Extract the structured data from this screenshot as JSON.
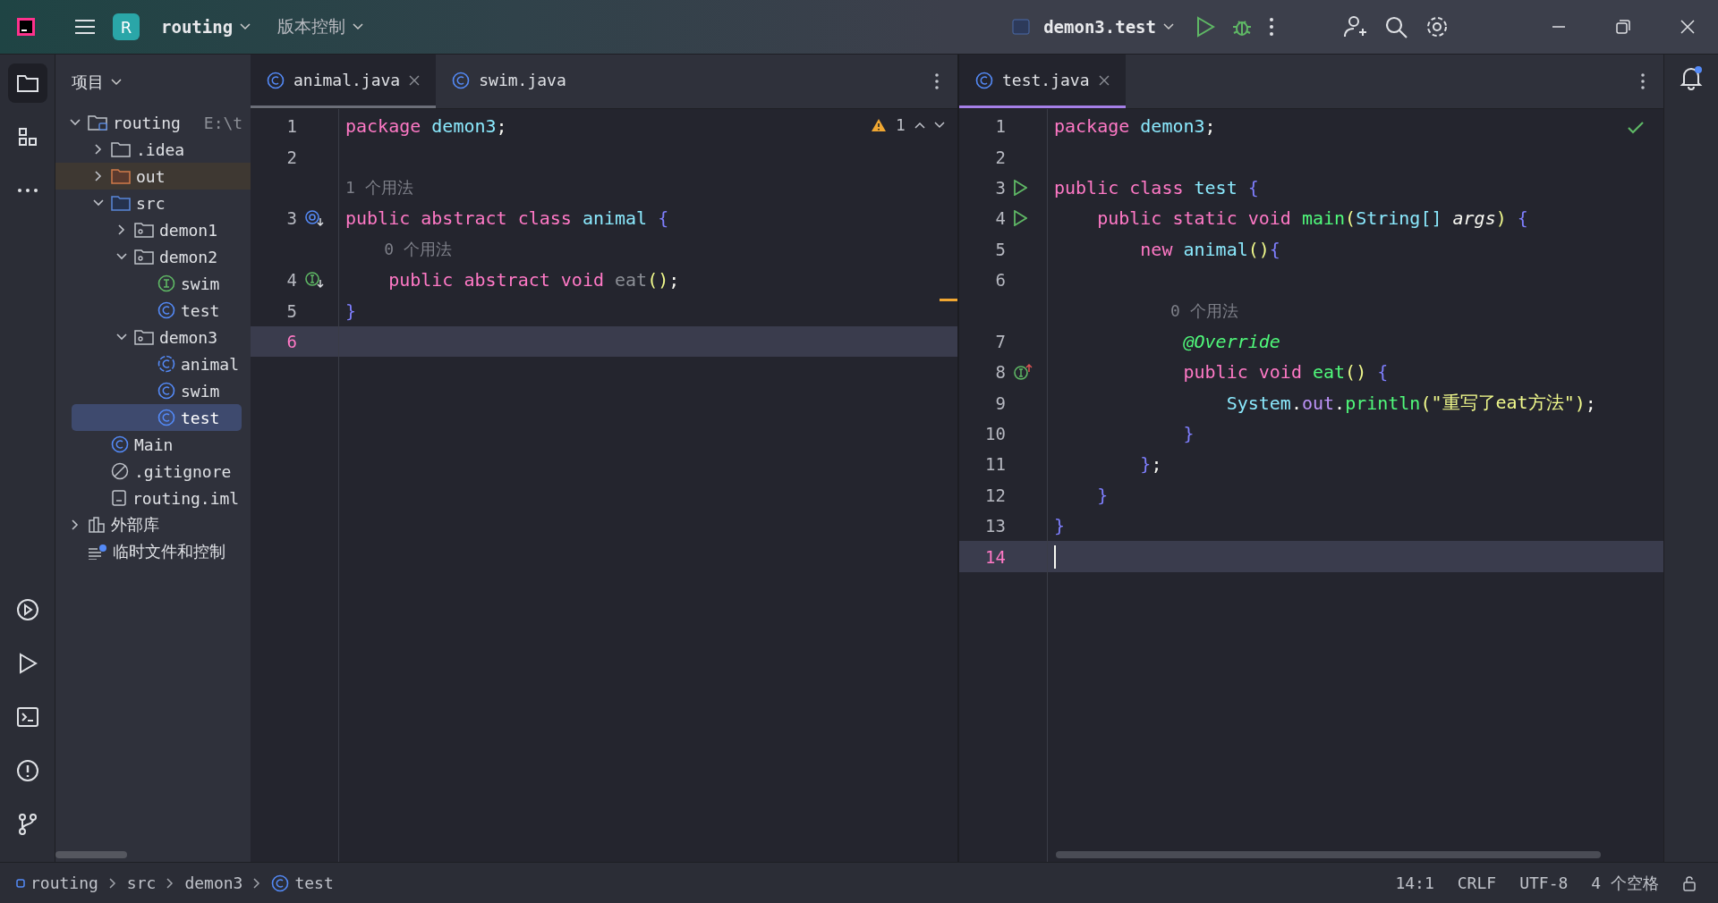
{
  "title_bar": {
    "project_badge": "R",
    "project": "routing",
    "vcs": "版本控制",
    "run_config": "demon3.test"
  },
  "tool_strip": {
    "top": [
      {
        "kind": "project",
        "selected": true
      },
      {
        "kind": "structure",
        "selected": false
      },
      {
        "kind": "more",
        "selected": false
      }
    ],
    "bottom": [
      {
        "kind": "services",
        "selected": false
      },
      {
        "kind": "run",
        "selected": false
      },
      {
        "kind": "terminal",
        "selected": false
      },
      {
        "kind": "problems",
        "selected": false
      },
      {
        "kind": "git",
        "selected": false
      }
    ]
  },
  "project_panel": {
    "title": "项目",
    "tree": [
      {
        "label": "routing",
        "kind": "module-folder",
        "note": "E:\\t",
        "expanded": true,
        "selected": false,
        "children": [
          {
            "label": ".idea",
            "kind": "folder",
            "expanded": false,
            "selected": false
          },
          {
            "label": "out",
            "kind": "excluded-folder",
            "expanded": false,
            "selected": false
          },
          {
            "label": "src",
            "kind": "source-folder",
            "expanded": true,
            "selected": false,
            "children": [
              {
                "label": "demon1",
                "kind": "package",
                "expanded": false,
                "selected": false
              },
              {
                "label": "demon2",
                "kind": "package",
                "expanded": true,
                "selected": false,
                "children": [
                  {
                    "label": "swim",
                    "kind": "interface",
                    "selected": false
                  },
                  {
                    "label": "test",
                    "kind": "class",
                    "selected": false
                  }
                ]
              },
              {
                "label": "demon3",
                "kind": "package",
                "expanded": true,
                "selected": false,
                "children": [
                  {
                    "label": "animal",
                    "kind": "abstract-class",
                    "selected": false
                  },
                  {
                    "label": "swim",
                    "kind": "class",
                    "selected": false
                  },
                  {
                    "label": "test",
                    "kind": "class",
                    "selected": true
                  }
                ]
              }
            ]
          },
          {
            "label": "Main",
            "kind": "class",
            "selected": false
          },
          {
            "label": ".gitignore",
            "kind": "ignore-file",
            "selected": false
          },
          {
            "label": "routing.iml",
            "kind": "iml-file",
            "selected": false
          }
        ]
      },
      {
        "label": "外部库",
        "kind": "library",
        "expanded": false,
        "selected": false
      },
      {
        "label": "临时文件和控制",
        "kind": "scratches",
        "selected": false
      }
    ]
  },
  "left_editor": {
    "focused": false,
    "tabs": [
      {
        "label": "animal.java",
        "selected": true
      },
      {
        "label": "swim.java",
        "selected": false
      }
    ],
    "inspection": {
      "kind": "warning",
      "count": "1"
    },
    "lines": [
      {
        "kind": "code",
        "number": "1",
        "tokens": [
          {
            "t": "package",
            "kind": "kw",
            "space_after": true
          },
          {
            "t": "demon3",
            "kind": "cls"
          },
          {
            "t": ";",
            "kind": "plain"
          }
        ]
      },
      {
        "kind": "code",
        "number": "2"
      },
      {
        "kind": "hint",
        "text": "1 个用法"
      },
      {
        "kind": "code",
        "number": "3",
        "gutter": {
          "kind": "overridden"
        },
        "tokens": [
          {
            "t": "public",
            "kind": "kw",
            "space_after": true
          },
          {
            "t": "abstract",
            "kind": "kw",
            "space_after": true
          },
          {
            "t": "class",
            "kind": "kw",
            "space_after": true
          },
          {
            "t": "animal",
            "kind": "cls",
            "space_after": true
          },
          {
            "t": "{",
            "kind": "brace"
          }
        ]
      },
      {
        "kind": "hint",
        "text": "    0 个用法"
      },
      {
        "kind": "code",
        "number": "4",
        "gutter": {
          "kind": "implemented"
        },
        "tokens": [
          {
            "t": "    public",
            "kind": "kw",
            "space_after": true
          },
          {
            "t": "abstract",
            "kind": "kw",
            "space_after": true
          },
          {
            "t": "void",
            "kind": "kw",
            "space_after": true
          },
          {
            "t": "eat",
            "kind": "unused"
          },
          {
            "t": "()",
            "kind": "paren"
          },
          {
            "t": ";",
            "kind": "plain"
          }
        ]
      },
      {
        "kind": "code",
        "number": "5",
        "tokens": [
          {
            "t": "}",
            "kind": "brace"
          }
        ]
      },
      {
        "kind": "code",
        "number": "6",
        "current": true
      }
    ]
  },
  "right_editor": {
    "focused": true,
    "tabs": [
      {
        "label": "test.java",
        "selected": true
      }
    ],
    "inspection": {
      "kind": "ok"
    },
    "lines": [
      {
        "kind": "code",
        "number": "1",
        "tokens": [
          {
            "t": "package",
            "kind": "kw",
            "space_after": true
          },
          {
            "t": "demon3",
            "kind": "cls"
          },
          {
            "t": ";",
            "kind": "plain"
          }
        ]
      },
      {
        "kind": "code",
        "number": "2"
      },
      {
        "kind": "code",
        "number": "3",
        "gutter": {
          "kind": "run"
        },
        "tokens": [
          {
            "t": "public",
            "kind": "kw",
            "space_after": true
          },
          {
            "t": "class",
            "kind": "kw",
            "space_after": true
          },
          {
            "t": "test",
            "kind": "cls",
            "space_after": true
          },
          {
            "t": "{",
            "kind": "brace"
          }
        ]
      },
      {
        "kind": "code",
        "number": "4",
        "gutter": {
          "kind": "run"
        },
        "tokens": [
          {
            "t": "    public",
            "kind": "kw",
            "space_after": true
          },
          {
            "t": "static",
            "kind": "kw",
            "space_after": true
          },
          {
            "t": "void",
            "kind": "kw",
            "space_after": true
          },
          {
            "t": "main",
            "kind": "method"
          },
          {
            "t": "(",
            "kind": "paren"
          },
          {
            "t": "String[]",
            "kind": "cls",
            "space_after": true
          },
          {
            "t": "args",
            "kind": "param"
          },
          {
            "t": ")",
            "kind": "paren",
            "space_after": true
          },
          {
            "t": "{",
            "kind": "brace"
          }
        ]
      },
      {
        "kind": "code",
        "number": "5",
        "tokens": [
          {
            "t": "        new",
            "kind": "kw",
            "space_after": true
          },
          {
            "t": "animal",
            "kind": "cls"
          },
          {
            "t": "()",
            "kind": "paren"
          },
          {
            "t": "{",
            "kind": "brace"
          }
        ]
      },
      {
        "kind": "code",
        "number": "6"
      },
      {
        "kind": "hint",
        "text": "            0 个用法"
      },
      {
        "kind": "code",
        "number": "7",
        "tokens": [
          {
            "t": "            @Override",
            "kind": "annotation"
          }
        ]
      },
      {
        "kind": "code",
        "number": "8",
        "gutter": {
          "kind": "implements"
        },
        "tokens": [
          {
            "t": "            public",
            "kind": "kw",
            "space_after": true
          },
          {
            "t": "void",
            "kind": "kw",
            "space_after": true
          },
          {
            "t": "eat",
            "kind": "method"
          },
          {
            "t": "()",
            "kind": "paren",
            "space_after": true
          },
          {
            "t": "{",
            "kind": "brace"
          }
        ]
      },
      {
        "kind": "code",
        "number": "9",
        "tokens": [
          {
            "t": "                System",
            "kind": "cls"
          },
          {
            "t": ".",
            "kind": "plain"
          },
          {
            "t": "out",
            "kind": "field"
          },
          {
            "t": ".",
            "kind": "plain"
          },
          {
            "t": "println",
            "kind": "method"
          },
          {
            "t": "(",
            "kind": "paren"
          },
          {
            "t": "\"重写了eat方法\"",
            "kind": "string"
          },
          {
            "t": ")",
            "kind": "paren"
          },
          {
            "t": ";",
            "kind": "plain"
          }
        ]
      },
      {
        "kind": "code",
        "number": "10",
        "tokens": [
          {
            "t": "            }",
            "kind": "brace"
          }
        ]
      },
      {
        "kind": "code",
        "number": "11",
        "tokens": [
          {
            "t": "        }",
            "kind": "brace"
          },
          {
            "t": ";",
            "kind": "plain"
          }
        ]
      },
      {
        "kind": "code",
        "number": "12",
        "tokens": [
          {
            "t": "    }",
            "kind": "brace"
          }
        ]
      },
      {
        "kind": "code",
        "number": "13",
        "tokens": [
          {
            "t": "}",
            "kind": "brace"
          }
        ]
      },
      {
        "kind": "code",
        "number": "14",
        "current": true,
        "caret": true
      }
    ]
  },
  "notifications": {
    "unread": true
  },
  "status_bar": {
    "breadcrumbs": [
      {
        "label": "routing",
        "kind": "module"
      },
      {
        "label": "src",
        "kind": "directory"
      },
      {
        "label": "demon3",
        "kind": "directory"
      },
      {
        "label": "test",
        "kind": "class"
      }
    ],
    "position": "14:1",
    "line_separator": "CRLF",
    "encoding": "UTF-8",
    "indent": "4 个空格"
  }
}
